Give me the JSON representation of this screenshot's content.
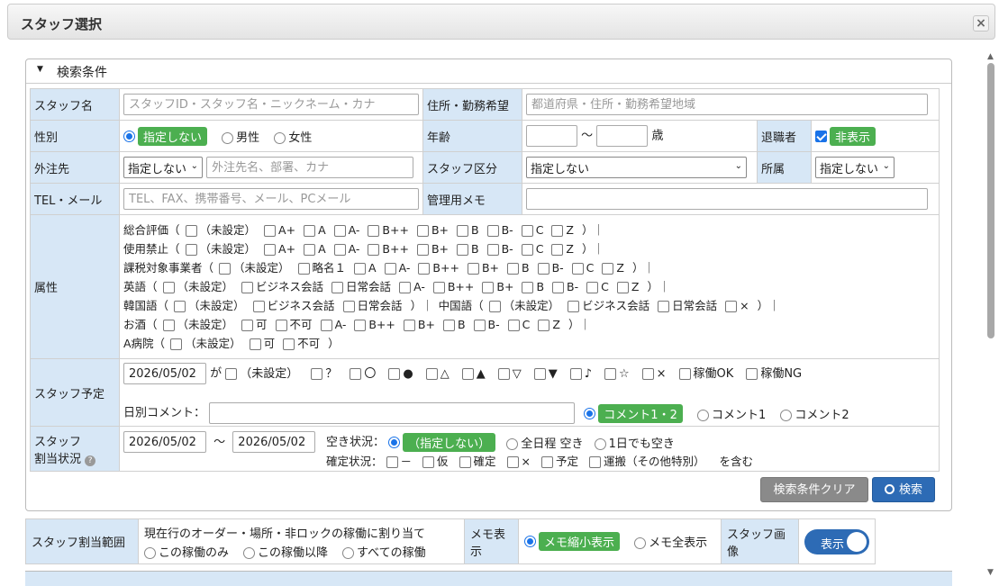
{
  "dialog": {
    "title": "スタッフ選択"
  },
  "panel": {
    "title": "検索条件"
  },
  "form": {
    "staff_name": {
      "label": "スタッフ名",
      "placeholder": "スタッフID・スタッフ名・ニックネーム・カナ"
    },
    "address": {
      "label": "住所・勤務希望",
      "placeholder": "都道府県・住所・勤務希望地域"
    },
    "gender": {
      "label": "性別",
      "opt_none": "指定しない",
      "opt_male": "男性",
      "opt_female": "女性"
    },
    "age": {
      "label": "年齢",
      "sep": "〜",
      "unit": "歳"
    },
    "retired": {
      "label": "退職者",
      "value": "非表示"
    },
    "outsource": {
      "label": "外注先",
      "select": "指定しない",
      "placeholder": "外注先名、部署、カナ"
    },
    "staff_type": {
      "label": "スタッフ区分",
      "select": "指定しない"
    },
    "affiliation": {
      "label": "所属",
      "select": "指定しない"
    },
    "contact": {
      "label": "TEL・メール",
      "placeholder": "TEL、FAX、携帯番号、メール、PCメール"
    },
    "memo": {
      "label": "管理用メモ"
    },
    "attributes": {
      "label": "属性",
      "l1": {
        "g": "総合評価（",
        "items": [
          "（未設定）",
          "A+",
          "A",
          "A-",
          "B++",
          "B+",
          "B",
          "B-",
          "C",
          "Z"
        ],
        "end": "）｜"
      },
      "l2": {
        "g": "使用禁止（",
        "items": [
          "（未設定）",
          "A+",
          "A",
          "A-",
          "B++",
          "B+",
          "B",
          "B-",
          "C",
          "Z"
        ],
        "end": "）｜"
      },
      "l3": {
        "g": "課税対象事業者（",
        "items": [
          "（未設定）",
          "略名１",
          "A",
          "A-",
          "B++",
          "B+",
          "B",
          "B-",
          "C",
          "Z"
        ],
        "end": "）｜"
      },
      "l4": {
        "g": "英語（",
        "items": [
          "（未設定）",
          "ビジネス会話",
          "日常会話",
          "A-",
          "B++",
          "B+",
          "B",
          "B-",
          "C",
          "Z"
        ],
        "end": "）｜"
      },
      "l5": {
        "g": "韓国語（",
        "items": [
          "（未設定）",
          "ビジネス会話",
          "日常会話"
        ],
        "end": "）｜",
        "g2": "中国語（",
        "items2": [
          "（未設定）",
          "ビジネス会話",
          "日常会話",
          "×"
        ],
        "end2": "）｜"
      },
      "l6": {
        "g": "お酒（",
        "items": [
          "（未設定）",
          "可",
          "不可",
          "A-",
          "B++",
          "B+",
          "B",
          "B-",
          "C",
          "Z"
        ],
        "end": "）｜"
      },
      "l7": {
        "g": "A病院（",
        "items": [
          "（未設定）",
          "可",
          "不可"
        ],
        "end": "）"
      }
    },
    "schedule": {
      "label": "スタッフ予定",
      "date": "2026/05/02",
      "ga": "が",
      "items": [
        "（未設定）",
        "？",
        "〇",
        "●",
        "△",
        "▲",
        "▽",
        "▼",
        "♪",
        "☆",
        "×",
        "稼働OK",
        "稼働NG"
      ],
      "comment_label": "日別コメント：",
      "opt_c12": "コメント1・2",
      "opt_c1": "コメント1",
      "opt_c2": "コメント2"
    },
    "assignment": {
      "label1": "スタッフ",
      "label2": "割当状況",
      "help_icon": "?",
      "date_from": "2026/05/02",
      "sep": "〜",
      "date_to": "2026/05/02",
      "vacancy_label": "空き状況：",
      "vac_none": "（指定しない）",
      "vac_all": "全日程 空き",
      "vac_one": "1日でも空き",
      "confirm_label": "確定状況：",
      "confirm_items": [
        "－",
        "仮",
        "確定",
        "×",
        "予定",
        "運搬（その他特別）"
      ],
      "include": "を含む"
    },
    "clear_button": "検索条件クリア",
    "search_button": "検索"
  },
  "bottom": {
    "range_label": "スタッフ割当範囲",
    "range_desc": "現在行のオーダー・場所・非ロックの稼働に割り当て",
    "range_opts": [
      "この稼働のみ",
      "この稼働以降",
      "すべての稼働"
    ],
    "memo_label": "メモ表示",
    "memo_short": "メモ縮小表示",
    "memo_full": "メモ全表示",
    "image_label": "スタッフ画像",
    "image_toggle": "表示"
  }
}
